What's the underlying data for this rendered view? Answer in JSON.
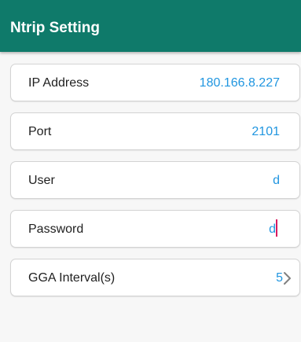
{
  "header": {
    "title": "Ntrip Setting"
  },
  "fields": {
    "ip_address": {
      "label": "IP Address",
      "value": "180.166.8.227"
    },
    "port": {
      "label": "Port",
      "value": "2101"
    },
    "user": {
      "label": "User",
      "value": "d"
    },
    "password": {
      "label": "Password",
      "value": "d"
    },
    "gga_interval": {
      "label": "GGA Interval(s)",
      "value": "5",
      "icon": "chevron-right-icon"
    }
  },
  "colors": {
    "app_bar": "#0f7a6a",
    "value_text": "#2196e0",
    "cursor": "#d81b60"
  }
}
